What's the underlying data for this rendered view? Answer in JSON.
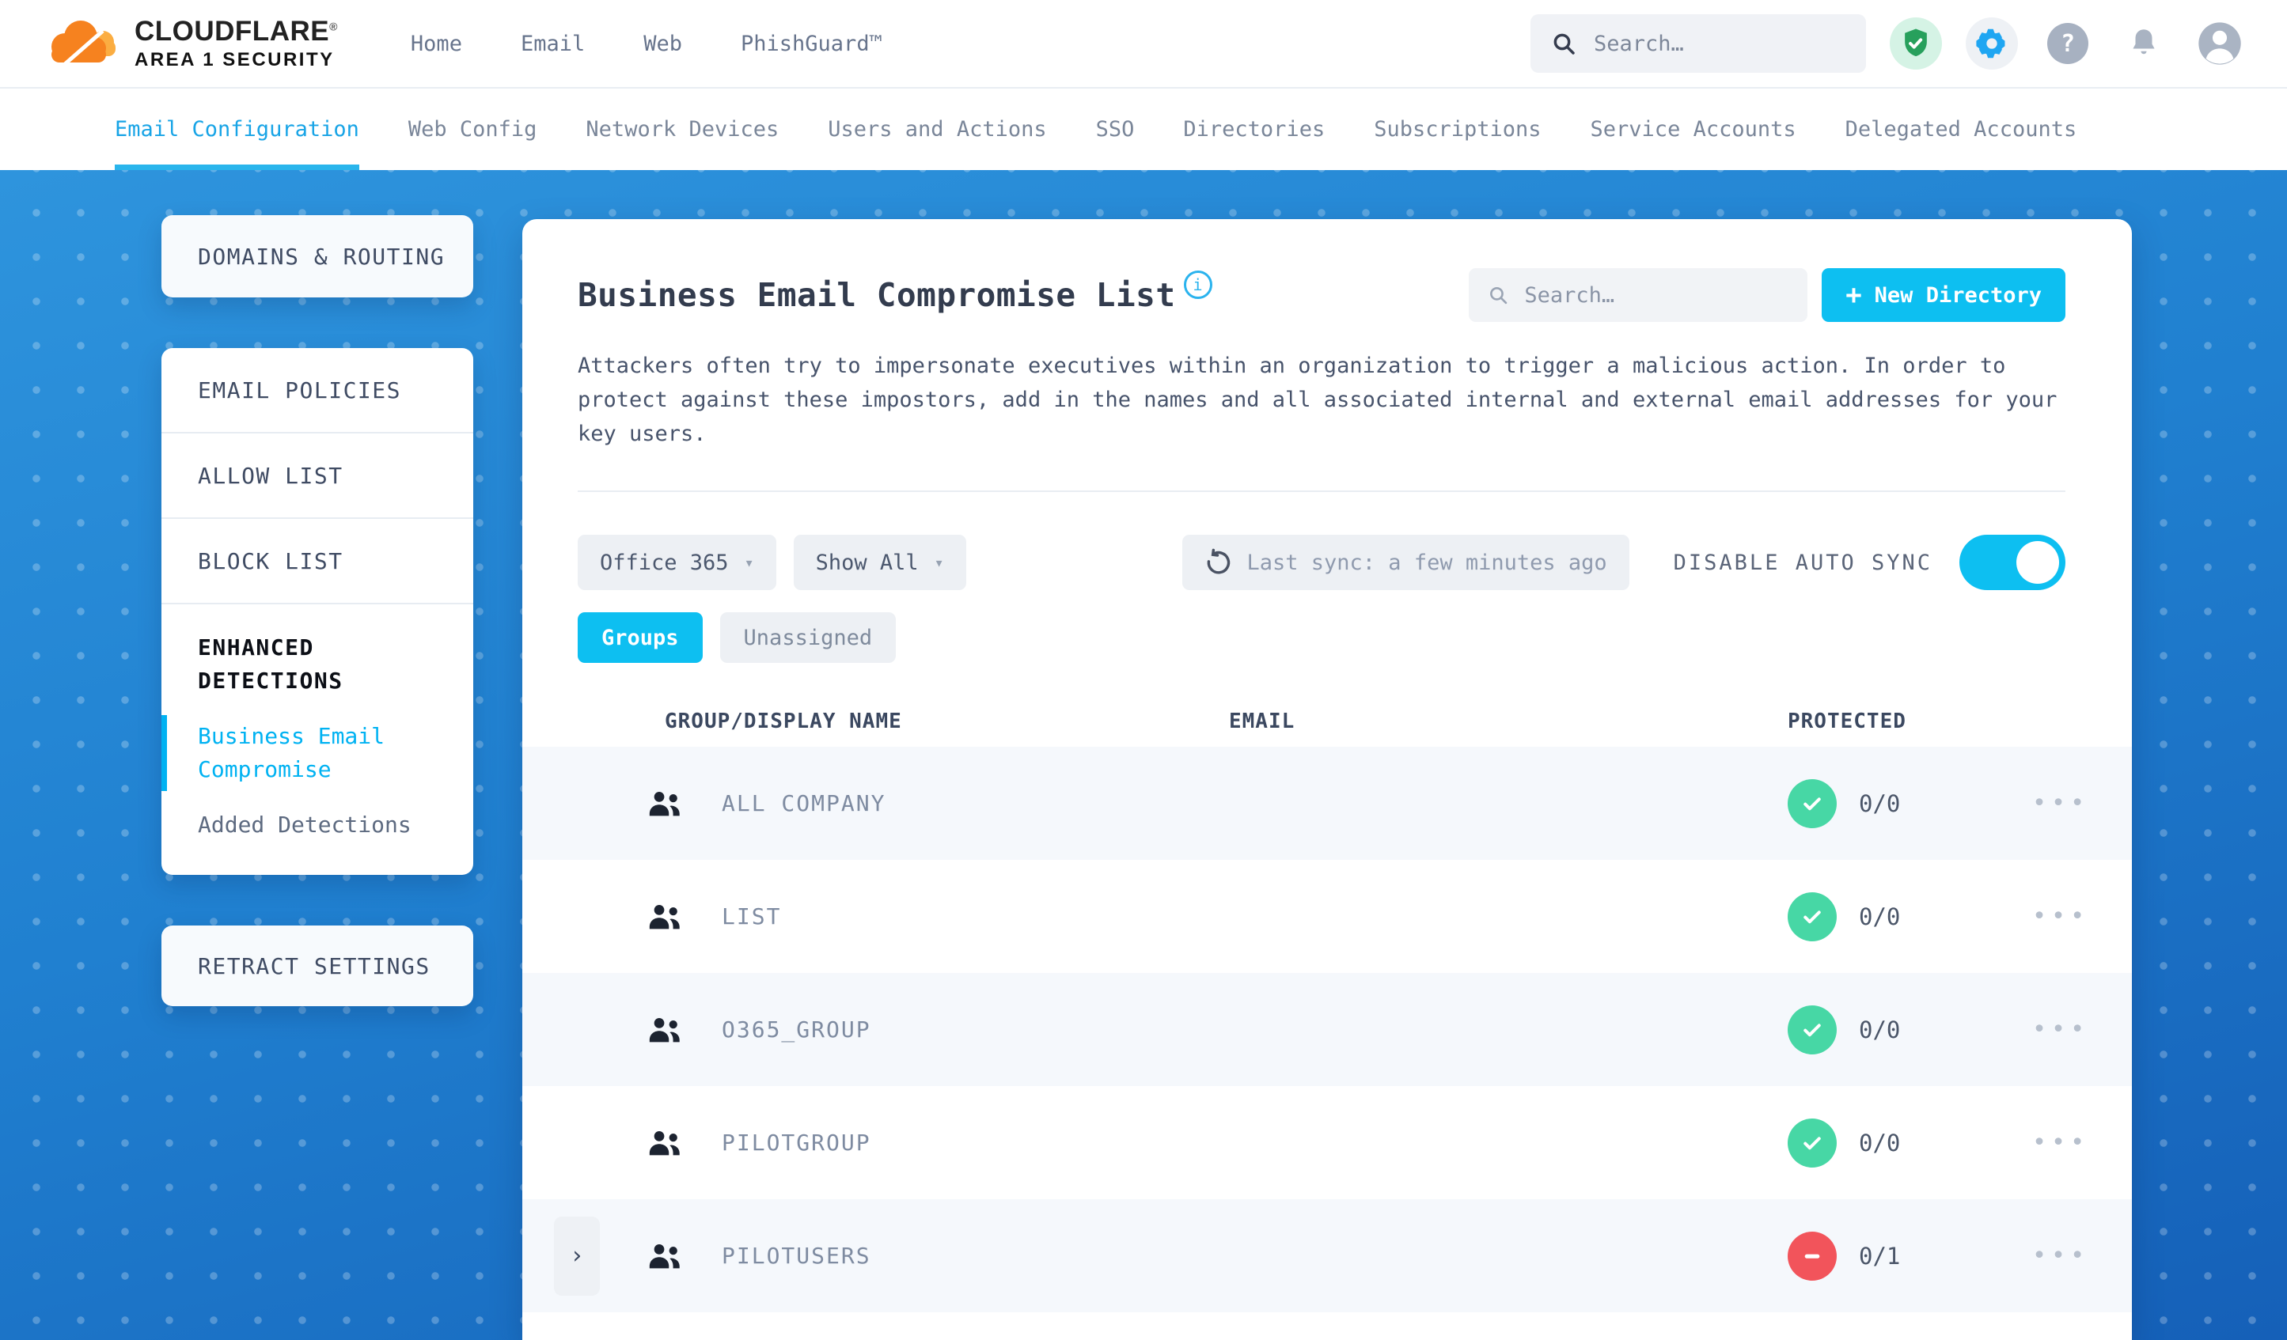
{
  "colors": {
    "accent": "#0dbff1",
    "link": "#00b2f2",
    "tab-active": "#18a4e6",
    "success": "#47d7a5",
    "danger": "#f2545b",
    "gear": "#1fa6f2",
    "shield": "#27a05c",
    "shield-bg": "#d5f3e5"
  },
  "header": {
    "logo": {
      "line1": "CLOUDFLARE",
      "registered": "®",
      "line2": "AREA 1 SECURITY"
    },
    "nav": [
      {
        "label": "Home"
      },
      {
        "label": "Email"
      },
      {
        "label": "Web"
      },
      {
        "label": "PhishGuard™"
      }
    ],
    "search": {
      "placeholder": "Search…"
    }
  },
  "tabs": [
    {
      "label": "Email Configuration",
      "active": true
    },
    {
      "label": "Web Config",
      "active": false
    },
    {
      "label": "Network Devices",
      "active": false
    },
    {
      "label": "Users and Actions",
      "active": false
    },
    {
      "label": "SSO",
      "active": false
    },
    {
      "label": "Directories",
      "active": false
    },
    {
      "label": "Subscriptions",
      "active": false
    },
    {
      "label": "Service Accounts",
      "active": false
    },
    {
      "label": "Delegated Accounts",
      "active": false
    }
  ],
  "sidebar": {
    "domains_routing": "DOMAINS & ROUTING",
    "policy_items": [
      "EMAIL POLICIES",
      "ALLOW LIST",
      "BLOCK LIST"
    ],
    "enhanced_title": "ENHANCED DETECTIONS",
    "enhanced_links": [
      {
        "label": "Business Email Compromise",
        "active": true
      },
      {
        "label": "Added Detections",
        "active": false
      }
    ],
    "retract": "RETRACT SETTINGS"
  },
  "main": {
    "title": "Business Email Compromise List",
    "info_icon": "i",
    "search": {
      "placeholder": "Search…"
    },
    "new_directory": {
      "plus": "+",
      "label": "New Directory"
    },
    "description": "Attackers often try to impersonate executives within an organization to trigger a malicious action. In order to protect against these impostors, add in the names and all associated internal and external email addresses for your key users.",
    "filters": {
      "directory_value": "Office 365",
      "show_value": "Show All",
      "caret": "▾"
    },
    "sync": {
      "label": "Last sync: a few minutes ago"
    },
    "auto_sync": {
      "label": "DISABLE AUTO SYNC",
      "on": true
    },
    "view_tabs": [
      {
        "label": "Groups",
        "active": true
      },
      {
        "label": "Unassigned",
        "active": false
      }
    ],
    "table": {
      "columns": [
        "GROUP/DISPLAY NAME",
        "EMAIL",
        "PROTECTED"
      ],
      "dots": "•••",
      "chevron": "›",
      "rows": [
        {
          "name": "ALL COMPANY",
          "email": "",
          "count": "0/0",
          "protected": true,
          "expandable": false
        },
        {
          "name": "LIST",
          "email": "",
          "count": "0/0",
          "protected": true,
          "expandable": false
        },
        {
          "name": "O365_GROUP",
          "email": "",
          "count": "0/0",
          "protected": true,
          "expandable": false
        },
        {
          "name": "PILOTGROUP",
          "email": "",
          "count": "0/0",
          "protected": true,
          "expandable": false
        },
        {
          "name": "PILOTUSERS",
          "email": "",
          "count": "0/1",
          "protected": false,
          "expandable": true
        }
      ]
    }
  }
}
